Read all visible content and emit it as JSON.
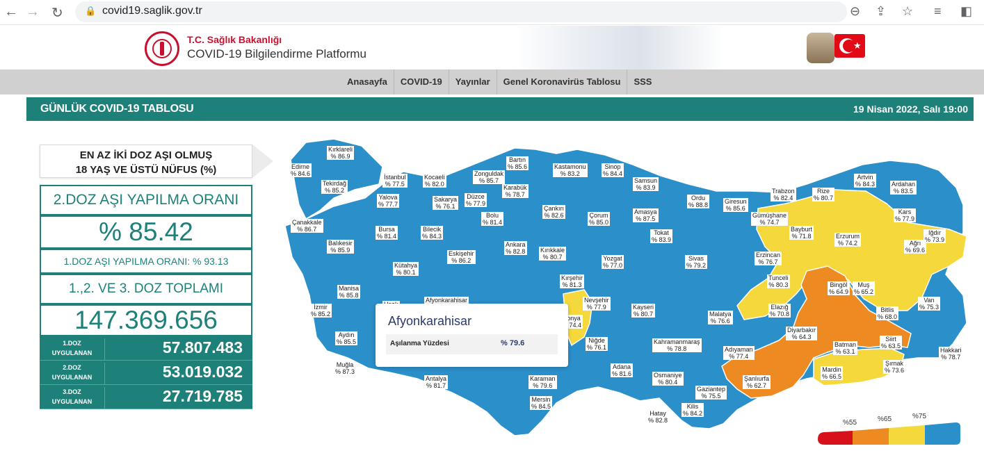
{
  "browser": {
    "url": "covid19.saglik.gov.tr"
  },
  "header": {
    "ministry": "T.C. Sağlık Bakanlığı",
    "platform": "COVID-19 Bilgilendirme Platformu"
  },
  "menu": [
    {
      "label": "Anasayfa"
    },
    {
      "label": "COVID-19"
    },
    {
      "label": "Yayınlar"
    },
    {
      "label": "Genel Koronavirüs Tablosu"
    },
    {
      "label": "SSS"
    }
  ],
  "titlebar": {
    "title": "GÜNLÜK COVID-19 TABLOSU",
    "date": "19 Nisan 2022, Salı 19:00"
  },
  "stats": {
    "heading_line1": "EN AZ İKİ DOZ AŞI OLMUŞ",
    "heading_line2": "18 YAŞ VE ÜSTÜ NÜFUS (%)",
    "dose2_rate_label": "2.DOZ AŞI YAPILMA ORANI",
    "dose2_rate_value": "% 85.42",
    "dose1_rate_text": "1.DOZ AŞI YAPILMA ORANI: % 93.13",
    "total_label": "1.,2. VE 3. DOZ TOPLAMI",
    "total_value": "147.369.656",
    "doses": [
      {
        "label1": "1.DOZ",
        "label2": "UYGULANAN",
        "value": "57.807.483"
      },
      {
        "label1": "2.DOZ",
        "label2": "UYGULANAN",
        "value": "53.019.032"
      },
      {
        "label1": "3.DOZ",
        "label2": "UYGULANAN",
        "value": "27.719.785"
      }
    ]
  },
  "map": {
    "colors": {
      "blue": "#2b8fc9",
      "yellow": "#f5d93c",
      "orange": "#ee8a22",
      "red": "#d8101c",
      "border": "#ffffff"
    },
    "provinces": [
      {
        "name": "Kırklareli",
        "value": "% 86.9"
      },
      {
        "name": "Edirne",
        "value": "% 84.6"
      },
      {
        "name": "Tekirdağ",
        "value": "% 85.2"
      },
      {
        "name": "İstanbul",
        "value": "% 77.5"
      },
      {
        "name": "Kocaeli",
        "value": "% 82.0"
      },
      {
        "name": "Zonguldak",
        "value": "% 85.7"
      },
      {
        "name": "Bartın",
        "value": "% 85.6"
      },
      {
        "name": "Kastamonu",
        "value": "% 83.2"
      },
      {
        "name": "Sinop",
        "value": "% 84.4"
      },
      {
        "name": "Samsun",
        "value": "% 83.9"
      },
      {
        "name": "Artvin",
        "value": "% 84.3"
      },
      {
        "name": "Ardahan",
        "value": "% 83.5"
      },
      {
        "name": "Yalova",
        "value": "% 77.7"
      },
      {
        "name": "Sakarya",
        "value": "% 76.1"
      },
      {
        "name": "Düzce",
        "value": "% 77.9"
      },
      {
        "name": "Karabük",
        "value": "% 78.7"
      },
      {
        "name": "Trabzon",
        "value": "% 82.4"
      },
      {
        "name": "Rize",
        "value": "% 80.7"
      },
      {
        "name": "Ordu",
        "value": "% 88.8"
      },
      {
        "name": "Giresun",
        "value": "% 85.6"
      },
      {
        "name": "Kars",
        "value": "% 77.9"
      },
      {
        "name": "Çanakkale",
        "value": "% 86.7"
      },
      {
        "name": "Bursa",
        "value": "% 81.4"
      },
      {
        "name": "Bilecik",
        "value": "% 84.3"
      },
      {
        "name": "Bolu",
        "value": "% 81.4"
      },
      {
        "name": "Çankırı",
        "value": "% 82.6"
      },
      {
        "name": "Çorum",
        "value": "% 85.0"
      },
      {
        "name": "Amasya",
        "value": "% 87.5"
      },
      {
        "name": "Gümüşhane",
        "value": "% 74.7"
      },
      {
        "name": "Bayburt",
        "value": "% 71.8"
      },
      {
        "name": "Erzurum",
        "value": "% 74.2"
      },
      {
        "name": "Iğdır",
        "value": "% 73.9"
      },
      {
        "name": "Tokat",
        "value": "% 83.9"
      },
      {
        "name": "Balıkesir",
        "value": "% 85.9"
      },
      {
        "name": "Eskişehir",
        "value": "% 86.2"
      },
      {
        "name": "Ankara",
        "value": "% 82.8"
      },
      {
        "name": "Kırıkkale",
        "value": "% 80.7"
      },
      {
        "name": "Yozgat",
        "value": "% 77.0"
      },
      {
        "name": "Sivas",
        "value": "% 79.2"
      },
      {
        "name": "Erzincan",
        "value": "% 76.7"
      },
      {
        "name": "Ağrı",
        "value": "% 69.6"
      },
      {
        "name": "Kütahya",
        "value": "% 80.1"
      },
      {
        "name": "Kırşehir",
        "value": "% 81.3"
      },
      {
        "name": "Tunceli",
        "value": "% 80.3"
      },
      {
        "name": "Bingöl",
        "value": "% 64.9"
      },
      {
        "name": "Muş",
        "value": "% 65.2"
      },
      {
        "name": "Manisa",
        "value": "% 85.8"
      },
      {
        "name": "Nevşehir",
        "value": "% 77.9"
      },
      {
        "name": "Kayseri",
        "value": "% 80.7"
      },
      {
        "name": "Van",
        "value": "% 75.3"
      },
      {
        "name": "İzmir",
        "value": "% 85.2"
      },
      {
        "name": "Uşak",
        "value": ""
      },
      {
        "name": "Afyonkarahisar",
        "value": ""
      },
      {
        "name": "Malatya",
        "value": "% 76.6"
      },
      {
        "name": "Elazığ",
        "value": "% 70.8"
      },
      {
        "name": "Bitlis",
        "value": "% 68.0"
      },
      {
        "name": "Diyarbakır",
        "value": "% 64.3"
      },
      {
        "name": "Aydın",
        "value": "% 85.5"
      },
      {
        "name": "Niğde",
        "value": "% 76.1"
      },
      {
        "name": "Kahramanmaraş",
        "value": "% 78.8"
      },
      {
        "name": "Siirt",
        "value": "% 63.5"
      },
      {
        "name": "Batman",
        "value": "% 63.1"
      },
      {
        "name": "Adıyaman",
        "value": "% 77.4"
      },
      {
        "name": "Hakkari",
        "value": "% 78.7"
      },
      {
        "name": "Muğla",
        "value": "% 87.3"
      },
      {
        "name": "Adana",
        "value": "% 81.6"
      },
      {
        "name": "Osmaniye",
        "value": "% 80.4"
      },
      {
        "name": "Şırnak",
        "value": "% 73.6"
      },
      {
        "name": "Antalya",
        "value": "% 81.7"
      },
      {
        "name": "Karaman",
        "value": "% 79.6"
      },
      {
        "name": "Şanlıurfa",
        "value": "% 62.7"
      },
      {
        "name": "Mardin",
        "value": "% 66.5"
      },
      {
        "name": "Gaziantep",
        "value": "% 75.5"
      },
      {
        "name": "Mersin",
        "value": "% 84.5"
      },
      {
        "name": "Kilis",
        "value": "% 84.2"
      },
      {
        "name": "Hatay",
        "value": "% 82.8"
      },
      {
        "name": "Konya",
        "value": "% 74.4"
      }
    ]
  },
  "tooltip": {
    "province": "Afyonkarahisar",
    "key": "Aşılanma Yüzdesi",
    "value": "% 79.6"
  },
  "legend": {
    "thresholds": [
      "%55",
      "%65",
      "%75"
    ],
    "colors": [
      "#d8101c",
      "#ee8a22",
      "#f5d93c",
      "#2b8fc9"
    ]
  }
}
